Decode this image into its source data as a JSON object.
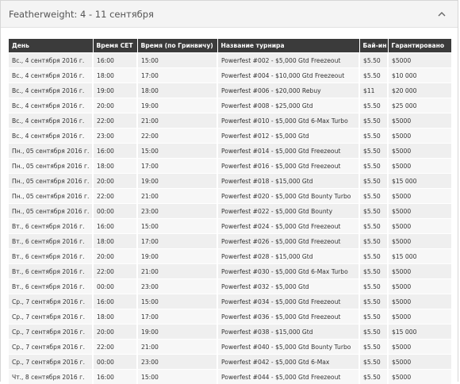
{
  "panel": {
    "title": "Featherweight: 4 - 11 сентября",
    "collapse_icon": "chevron-up-icon"
  },
  "table": {
    "columns": [
      "День",
      "Время CET",
      "Время (по Гринвичу)",
      "Название турнира",
      "Бай-ин",
      "Гарантировано"
    ],
    "rows": [
      [
        "Вс., 4 сентября 2016 г.",
        "16:00",
        "15:00",
        "Powerfest #002 - $5,000 Gtd Freezeout",
        "$5.50",
        "$5000"
      ],
      [
        "Вс., 4 сентября 2016 г.",
        "18:00",
        "17:00",
        "Powerfest #004 - $10,000 Gtd Freezeout",
        "$5.50",
        "$10 000"
      ],
      [
        "Вс., 4 сентября 2016 г.",
        "19:00",
        "18:00",
        "Powerfest #006 - $20,000 Rebuy",
        "$11",
        "$20 000"
      ],
      [
        "Вс., 4 сентября 2016 г.",
        "20:00",
        "19:00",
        "Powerfest #008 - $25,000 Gtd",
        "$5.50",
        "$25 000"
      ],
      [
        "Вс., 4 сентября 2016 г.",
        "22:00",
        "21:00",
        "Powerfest #010 - $5,000 Gtd 6-Max Turbo",
        "$5.50",
        "$5000"
      ],
      [
        "Вс., 4 сентября 2016 г.",
        "23:00",
        "22:00",
        "Powerfest #012 - $5,000 Gtd",
        "$5.50",
        "$5000"
      ],
      [
        "Пн., 05 сентября 2016 г.",
        "16:00",
        "15:00",
        "Powerfest #014 - $5,000 Gtd Freezeout",
        "$5.50",
        "$5000"
      ],
      [
        "Пн., 05 сентября 2016 г.",
        "18:00",
        "17:00",
        "Powerfest #016 - $5,000 Gtd Freezeout",
        "$5.50",
        "$5000"
      ],
      [
        "Пн., 05 сентября 2016 г.",
        "20:00",
        "19:00",
        "Powerfest #018 - $15,000 Gtd",
        "$5.50",
        "$15 000"
      ],
      [
        "Пн., 05 сентября 2016 г.",
        "22:00",
        "21:00",
        "Powerfest #020 - $5,000 Gtd Bounty Turbo",
        "$5.50",
        "$5000"
      ],
      [
        "Пн., 05 сентября 2016 г.",
        "00:00",
        "23:00",
        "Powerfest #022 - $5,000 Gtd Bounty",
        "$5.50",
        "$5000"
      ],
      [
        "Вт., 6 сентября 2016 г.",
        "16:00",
        "15:00",
        "Powerfest #024 - $5,000 Gtd Freezeout",
        "$5.50",
        "$5000"
      ],
      [
        "Вт., 6 сентября 2016 г.",
        "18:00",
        "17:00",
        "Powerfest #026 - $5,000 Gtd Freezeout",
        "$5.50",
        "$5000"
      ],
      [
        "Вт., 6 сентября 2016 г.",
        "20:00",
        "19:00",
        "Powerfest #028 - $15,000 Gtd",
        "$5.50",
        "$15 000"
      ],
      [
        "Вт., 6 сентября 2016 г.",
        "22:00",
        "21:00",
        "Powerfest #030 - $5,000 Gtd 6-Max Turbo",
        "$5.50",
        "$5000"
      ],
      [
        "Вт., 6 сентября 2016 г.",
        "00:00",
        "23:00",
        "Powerfest #032 - $5,000 Gtd",
        "$5.50",
        "$5000"
      ],
      [
        "Ср., 7 сентября 2016 г.",
        "16:00",
        "15:00",
        "Powerfest #034 - $5,000 Gtd Freezeout",
        "$5.50",
        "$5000"
      ],
      [
        "Ср., 7 сентября 2016 г.",
        "18:00",
        "17:00",
        "Powerfest #036 - $5,000 Gtd Freezeout",
        "$5.50",
        "$5000"
      ],
      [
        "Ср., 7 сентября 2016 г.",
        "20:00",
        "19:00",
        "Powerfest #038 - $15,000 Gtd",
        "$5.50",
        "$15 000"
      ],
      [
        "Ср., 7 сентября 2016 г.",
        "22:00",
        "21:00",
        "Powerfest #040 - $5,000 Gtd Bounty Turbo",
        "$5.50",
        "$5000"
      ],
      [
        "Ср., 7 сентября 2016 г.",
        "00:00",
        "23:00",
        "Powerfest #042 - $5,000 Gtd 6-Max",
        "$5.50",
        "$5000"
      ],
      [
        "Чт., 8 сентября 2016 г.",
        "16:00",
        "15:00",
        "Powerfest #044 - $5,000 Gtd Freezeout",
        "$5.50",
        "$5000"
      ]
    ]
  }
}
